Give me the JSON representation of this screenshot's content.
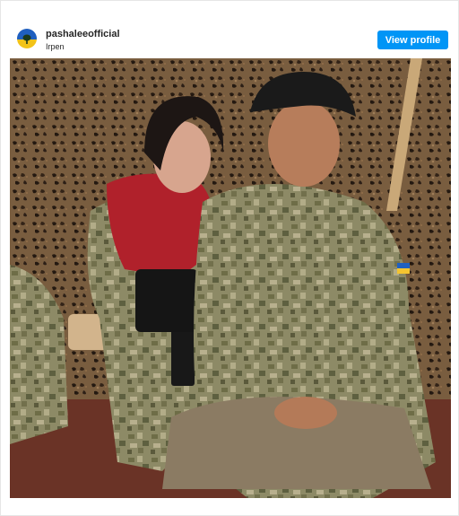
{
  "post": {
    "username": "pashaleeofficial",
    "location": "Irpen",
    "view_profile_label": "View profile"
  },
  "colors": {
    "button_blue": "#0095f6",
    "text_dark": "#262626",
    "avatar_blue": "#1f5fbf",
    "avatar_yellow": "#f2c318"
  },
  "icons": {
    "avatar": "ukraine-flag-tree-avatar"
  }
}
